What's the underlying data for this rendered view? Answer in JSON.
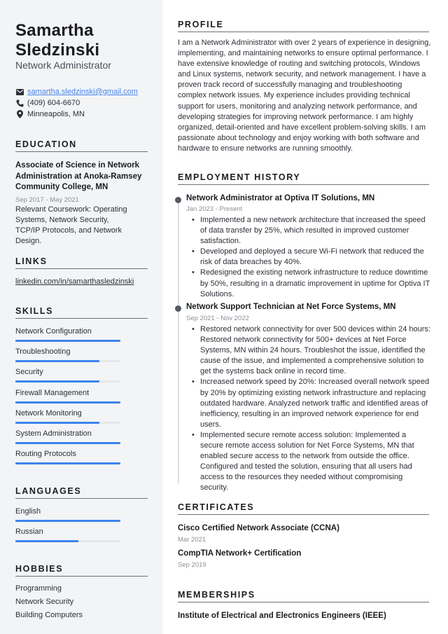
{
  "header": {
    "first_name": "Samartha",
    "last_name": "Sledzinski",
    "title": "Network Administrator"
  },
  "contact": {
    "email": "samartha.sledzinski@gmail.com",
    "email_icon": "envelope-icon",
    "phone": "(409) 604-6670",
    "phone_icon": "phone-icon",
    "location": "Minneapolis, MN",
    "location_icon": "map-pin-icon"
  },
  "education": {
    "heading": "EDUCATION",
    "degree": "Associate of Science in Network Administration at Anoka-Ramsey Community College, MN",
    "dates": "Sep 2017 - May 2021",
    "description": "Relevant Coursework: Operating Systems, Network Security, TCP/IP Protocols, and Network Design."
  },
  "links": {
    "heading": "LINKS",
    "items": [
      "linkedin.com/in/samarthasledzinski"
    ]
  },
  "skills": {
    "heading": "SKILLS",
    "items": [
      {
        "label": "Network Configuration",
        "level": 1.0
      },
      {
        "label": "Troubleshooting",
        "level": 0.8
      },
      {
        "label": "Security",
        "level": 0.8
      },
      {
        "label": "Firewall Management",
        "level": 1.0
      },
      {
        "label": "Network Monitoring",
        "level": 0.8
      },
      {
        "label": "System Administration",
        "level": 1.0
      },
      {
        "label": "Routing Protocols",
        "level": 1.0
      }
    ]
  },
  "languages": {
    "heading": "LANGUAGES",
    "items": [
      {
        "label": "English",
        "level": 1.0
      },
      {
        "label": "Russian",
        "level": 0.6
      }
    ]
  },
  "hobbies": {
    "heading": "HOBBIES",
    "items": [
      "Programming",
      "Network Security",
      "Building Computers"
    ]
  },
  "profile": {
    "heading": "PROFILE",
    "text": "I am a Network Administrator with over 2 years of experience in designing, implementing, and maintaining networks to ensure optimal performance. I have extensive knowledge of routing and switching protocols, Windows and Linux systems, network security, and network management. I have a proven track record of successfully managing and troubleshooting complex network issues. My experience includes providing technical support for users, monitoring and analyzing network performance, and developing strategies for improving network performance. I am highly organized, detail-oriented and have excellent problem-solving skills. I am passionate about technology and enjoy working with both software and hardware to ensure networks are running smoothly."
  },
  "employment": {
    "heading": "EMPLOYMENT HISTORY",
    "jobs": [
      {
        "title": "Network Administrator at Optiva IT Solutions, MN",
        "dates": "Jan 2023 - Present",
        "bullets": [
          "Implemented a new network architecture that increased the speed of data transfer by 25%, which resulted in improved customer satisfaction.",
          "Developed and deployed a secure Wi-Fi network that reduced the risk of data breaches by 40%.",
          "Redesigned the existing network infrastructure to reduce downtime by 50%, resulting in a dramatic improvement in uptime for Optiva IT Solutions."
        ]
      },
      {
        "title": "Network Support Technician at Net Force Systems, MN",
        "dates": "Sep 2021 - Nov 2022",
        "bullets": [
          "Restored network connectivity for over 500 devices within 24 hours: Restored network connectivity for 500+ devices at Net Force Systems, MN within 24 hours. Troubleshot the issue, identified the cause of the issue, and implemented a comprehensive solution to get the systems back online in record time.",
          "Increased network speed by 20%: Increased overall network speed by 20% by optimizing existing network infrastructure and replacing outdated hardware. Analyzed network traffic and identified areas of inefficiency, resulting in an improved network experience for end users.",
          "Implemented secure remote access solution: Implemented a secure remote access solution for Net Force Systems, MN that enabled secure access to the network from outside the office. Configured and tested the solution, ensuring that all users had access to the resources they needed without compromising security."
        ]
      }
    ]
  },
  "certificates": {
    "heading": "CERTIFICATES",
    "items": [
      {
        "name": "Cisco Certified Network Associate (CCNA)",
        "date": "Mar 2021"
      },
      {
        "name": "CompTIA Network+ Certification",
        "date": "Sep 2019"
      }
    ]
  },
  "memberships": {
    "heading": "MEMBERSHIPS",
    "items": [
      "Institute of Electrical and Electronics Engineers (IEEE)"
    ]
  },
  "colors": {
    "accent": "#3d84ee",
    "sidebar_bg": "#f3f4f6",
    "link": "#4a86e8"
  }
}
